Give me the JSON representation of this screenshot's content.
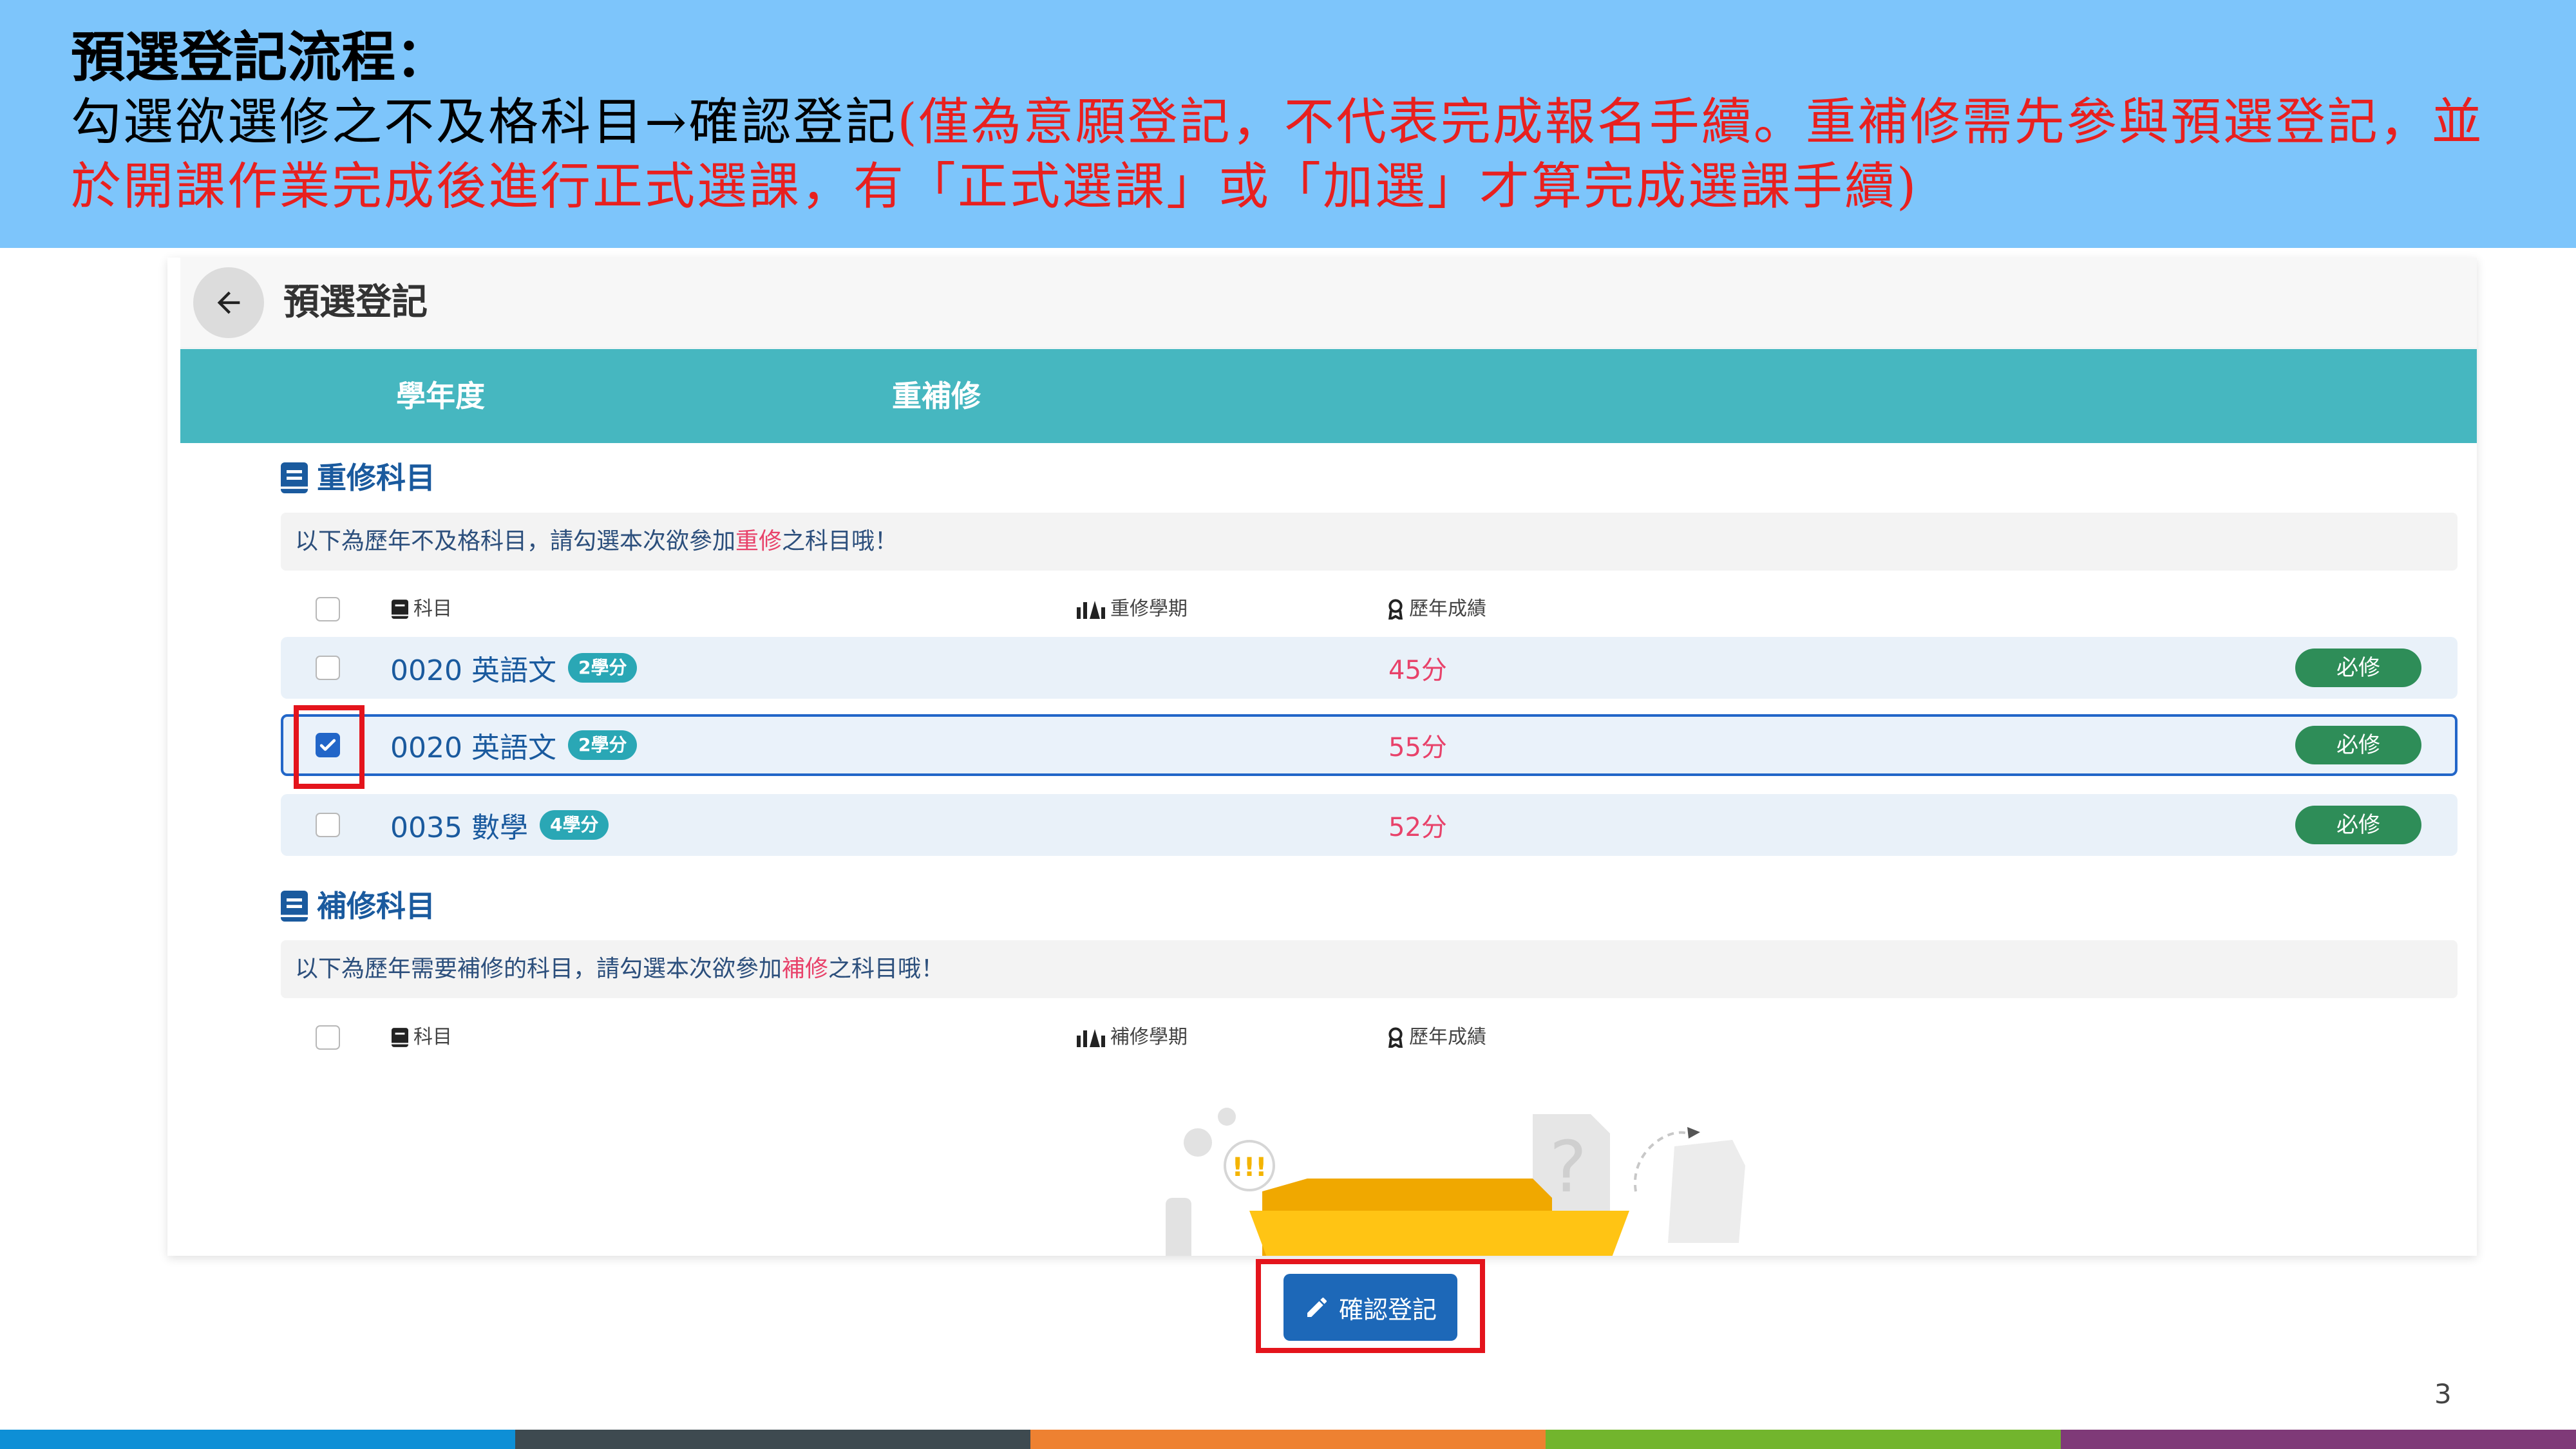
{
  "slide": {
    "title": "預選登記流程：",
    "lead": "勾選欲選修之不及格科目→確認登記",
    "note": "(僅為意願登記，不代表完成報名手續。重補修需先參與預選登記，並於開課作業完成後進行正式選課，有「正式選課」或「加選」才算完成選課手續)",
    "page_number": "3"
  },
  "app": {
    "page_title": "預選登記",
    "header_bar": {
      "col1": "學年度",
      "col2": "重補修"
    },
    "retake": {
      "section_title": "重修科目",
      "notice_prefix": "以下為歷年不及格科目，請勾選本次欲參加",
      "notice_highlight": "重修",
      "notice_suffix": "之科目哦！",
      "columns": {
        "subject": "科目",
        "term": "重修學期",
        "score": "歷年成績"
      },
      "rows": [
        {
          "course": "0020 英語文",
          "credit": "2學分",
          "score": "45分",
          "tag": "必修",
          "checked": false
        },
        {
          "course": "0020 英語文",
          "credit": "2學分",
          "score": "55分",
          "tag": "必修",
          "checked": true
        },
        {
          "course": "0035 數學",
          "credit": "4學分",
          "score": "52分",
          "tag": "必修",
          "checked": false
        }
      ]
    },
    "makeup": {
      "section_title": "補修科目",
      "notice_prefix": "以下為歷年需要補修的科目，請勾選本次欲參加",
      "notice_highlight": "補修",
      "notice_suffix": "之科目哦！",
      "columns": {
        "subject": "科目",
        "term": "補修學期",
        "score": "歷年成績"
      }
    },
    "confirm_label": "確認登記"
  },
  "colors": {
    "header_bg": "#7dc5fb",
    "teal": "#46b7c0",
    "primary": "#1d68b8",
    "accent_pink": "#e8426a",
    "required_green": "#2e8d58",
    "highlight_red": "#e4141c",
    "footer": [
      "#0e8fd6",
      "#3e4a50",
      "#ee8131",
      "#72b52d",
      "#7f3a78"
    ]
  }
}
